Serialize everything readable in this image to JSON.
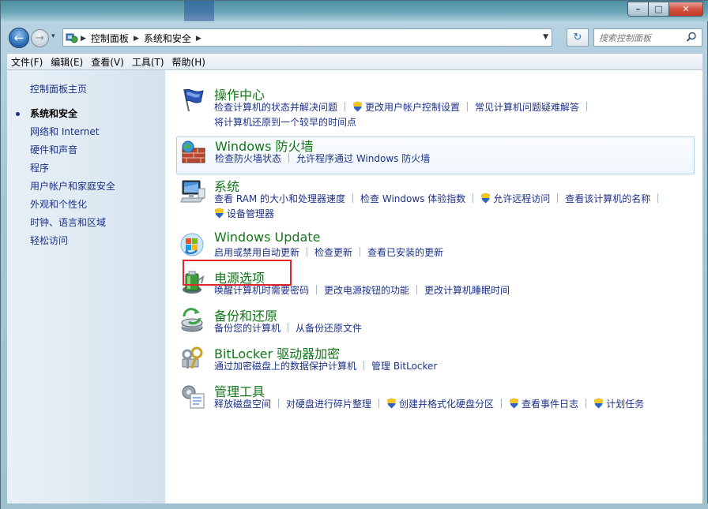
{
  "window": {
    "caption": {
      "minimize": "–",
      "maximize": "□",
      "close": "✕"
    }
  },
  "nav": {
    "back": "←",
    "forward": "→",
    "history": "▾",
    "breadcrumbs": [
      "控制面板",
      "系统和安全"
    ],
    "search_placeholder": "搜索控制面板",
    "refresh": "↻"
  },
  "menu": [
    "文件(F)",
    "编辑(E)",
    "查看(V)",
    "工具(T)",
    "帮助(H)"
  ],
  "left": {
    "home": "控制面板主页",
    "items": [
      "系统和安全",
      "网络和 Internet",
      "硬件和声音",
      "程序",
      "用户帐户和家庭安全",
      "外观和个性化",
      "时钟、语言和区域",
      "轻松访问"
    ],
    "active_index": 0
  },
  "categories": [
    {
      "title": "操作中心",
      "icon": "action-center-flag-icon",
      "links": [
        "检查计算机的状态并解决问题",
        "更改用户帐户控制设置",
        "常见计算机问题疑难解答",
        "将计算机还原到一个较早的时间点"
      ]
    },
    {
      "title": "Windows 防火墙",
      "icon": "firewall-brick-icon",
      "links": [
        "检查防火墙状态",
        "允许程序通过 Windows 防火墙"
      ]
    },
    {
      "title": "系统",
      "icon": "system-computer-icon",
      "links": [
        "查看 RAM 的大小和处理器速度",
        "检查 Windows 体验指数",
        "允许远程访问",
        "查看该计算机的名称",
        "设备管理器"
      ]
    },
    {
      "title": "Windows Update",
      "icon": "windows-update-icon",
      "links": [
        "启用或禁用自动更新",
        "检查更新",
        "查看已安装的更新"
      ]
    },
    {
      "title": "电源选项",
      "icon": "power-battery-icon",
      "links": [
        "唤醒计算机时需要密码",
        "更改电源按钮的功能",
        "更改计算机睡眠时间"
      ]
    },
    {
      "title": "备份和还原",
      "icon": "backup-restore-icon",
      "links": [
        "备份您的计算机",
        "从备份还原文件"
      ]
    },
    {
      "title": "BitLocker 驱动器加密",
      "icon": "bitlocker-keys-icon",
      "links": [
        "通过加密磁盘上的数据保护计算机",
        "管理 BitLocker"
      ]
    },
    {
      "title": "管理工具",
      "icon": "admin-tools-icon",
      "links": [
        "释放磁盘空间",
        "对硬盘进行碎片整理",
        "创建并格式化硬盘分区",
        "查看事件日志",
        "计划任务"
      ]
    }
  ],
  "colors": {
    "category_title": "#12761a",
    "link": "#1e3287",
    "highlight_box": "#e0262e"
  }
}
